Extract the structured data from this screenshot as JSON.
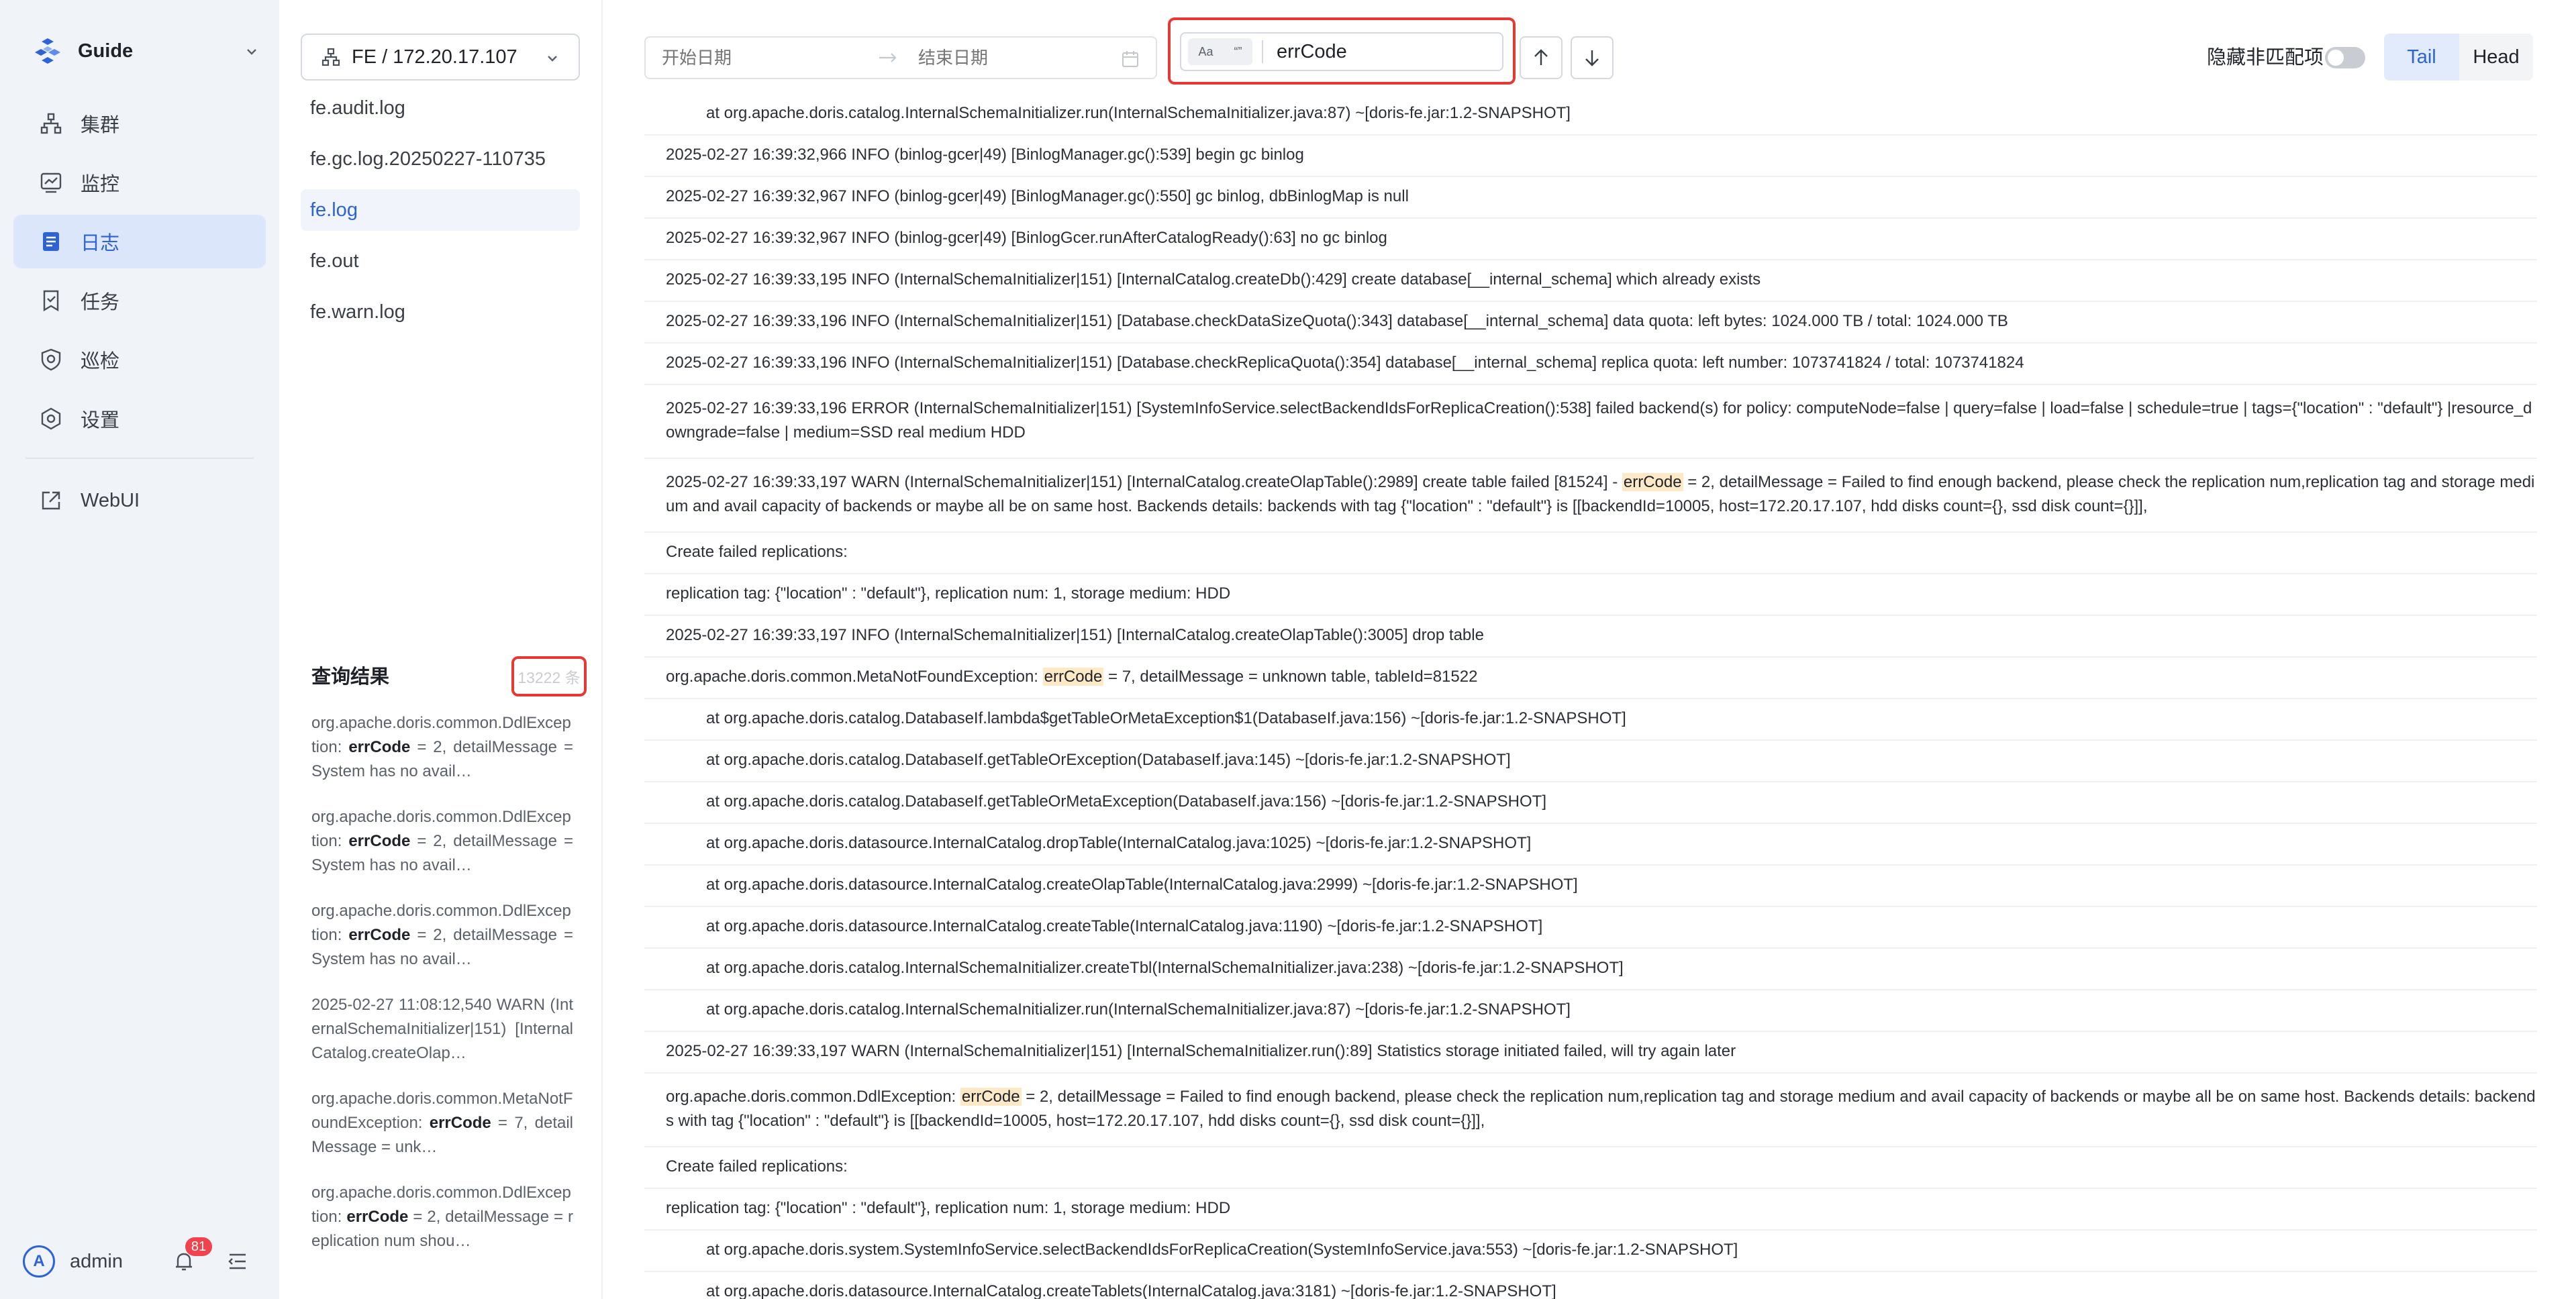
{
  "nav": {
    "brand": "Guide",
    "items": [
      {
        "label": "集群",
        "icon": "cluster-icon"
      },
      {
        "label": "监控",
        "icon": "monitor-icon"
      },
      {
        "label": "日志",
        "icon": "log-icon"
      },
      {
        "label": "任务",
        "icon": "task-icon"
      },
      {
        "label": "巡检",
        "icon": "inspect-icon"
      },
      {
        "label": "设置",
        "icon": "settings-icon"
      }
    ],
    "webui": "WebUI",
    "user": "admin",
    "avatar_letter": "A",
    "notifications": "81"
  },
  "files": {
    "node": "FE / 172.20.17.107",
    "items": [
      "fe.audit.log",
      "fe.gc.log.20250227-110735",
      "fe.log",
      "fe.out",
      "fe.warn.log"
    ],
    "active": "fe.log",
    "result_title": "查询结果",
    "result_count": "13222 条",
    "results": [
      {
        "pre": "org.apache.doris.common.DdlException: ",
        "key": "errCode",
        "post": " = 2, detailMessage = System has no avail…"
      },
      {
        "pre": "org.apache.doris.common.DdlException: ",
        "key": "errCode",
        "post": " = 2, detailMessage = System has no avail…"
      },
      {
        "pre": "org.apache.doris.common.DdlException: ",
        "key": "errCode",
        "post": " = 2, detailMessage = System has no avail…"
      },
      {
        "pre": "2025-02-27 11:08:12,540 WARN (InternalSchemaInitializer|151) [InternalCatalog.createOlap…",
        "key": "",
        "post": ""
      },
      {
        "pre": "org.apache.doris.common.MetaNotFoundException: ",
        "key": "errCode",
        "post": " = 7, detailMessage = unk…"
      },
      {
        "pre": "org.apache.doris.common.DdlException: ",
        "key": "errCode",
        "post": " = 2, detailMessage = replication num shou…"
      }
    ]
  },
  "toolbar": {
    "date_start_placeholder": "开始日期",
    "date_end_placeholder": "结束日期",
    "case_label": "Aa",
    "word_label": "“”",
    "search_value": "errCode",
    "hide_label": "隐藏非匹配项",
    "tail": "Tail",
    "head": "Head",
    "highlight_color": "#fde9c6",
    "accent_color": "#2e63d6",
    "alert_color": "#e53935"
  },
  "log_lines": [
    {
      "indent": true,
      "text": "at org.apache.doris.catalog.InternalSchemaInitializer.run(InternalSchemaInitializer.java:87) ~[doris-fe.jar:1.2-SNAPSHOT]"
    },
    {
      "text": "2025-02-27 16:39:32,966 INFO (binlog-gcer|49) [BinlogManager.gc():539] begin gc binlog"
    },
    {
      "text": "2025-02-27 16:39:32,967 INFO (binlog-gcer|49) [BinlogManager.gc():550] gc binlog, dbBinlogMap is null"
    },
    {
      "text": "2025-02-27 16:39:32,967 INFO (binlog-gcer|49) [BinlogGcer.runAfterCatalogReady():63] no gc binlog"
    },
    {
      "text": "2025-02-27 16:39:33,195 INFO (InternalSchemaInitializer|151) [InternalCatalog.createDb():429] create database[__internal_schema] which already exists"
    },
    {
      "text": "2025-02-27 16:39:33,196 INFO (InternalSchemaInitializer|151) [Database.checkDataSizeQuota():343] database[__internal_schema] data quota: left bytes: 1024.000 TB / total: 1024.000 TB"
    },
    {
      "text": "2025-02-27 16:39:33,196 INFO (InternalSchemaInitializer|151) [Database.checkReplicaQuota():354] database[__internal_schema] replica quota: left number: 1073741824 / total: 1073741824"
    },
    {
      "tall": true,
      "text": "2025-02-27 16:39:33,196 ERROR (InternalSchemaInitializer|151) [SystemInfoService.selectBackendIdsForReplicaCreation():538] failed backend(s) for policy: computeNode=false | query=false | load=false | schedule=true | tags={\"location\" : \"default\"} |resource_downgrade=false | medium=SSD real medium HDD"
    },
    {
      "tall": true,
      "pre": "2025-02-27 16:39:33,197 WARN (InternalSchemaInitializer|151) [InternalCatalog.createOlapTable():2989] create table failed [81524] - ",
      "key": "errCode",
      "post": " = 2, detailMessage = Failed to find enough backend, please check the replication num,replication tag and storage medium and avail capacity of backends or maybe all be on same host. Backends details: backends with tag {\"location\" : \"default\"} is [[backendId=10005, host=172.20.17.107, hdd disks count={}, ssd disk count={}]],"
    },
    {
      "text": "Create failed replications:"
    },
    {
      "text": "replication tag: {\"location\" : \"default\"}, replication num: 1, storage medium: HDD"
    },
    {
      "text": "2025-02-27 16:39:33,197 INFO (InternalSchemaInitializer|151) [InternalCatalog.createOlapTable():3005] drop table"
    },
    {
      "pre": "org.apache.doris.common.MetaNotFoundException: ",
      "key": "errCode",
      "post": " = 7, detailMessage = unknown table, tableId=81522"
    },
    {
      "indent": true,
      "text": "at org.apache.doris.catalog.DatabaseIf.lambda$getTableOrMetaException$1(DatabaseIf.java:156) ~[doris-fe.jar:1.2-SNAPSHOT]"
    },
    {
      "indent": true,
      "text": "at org.apache.doris.catalog.DatabaseIf.getTableOrException(DatabaseIf.java:145) ~[doris-fe.jar:1.2-SNAPSHOT]"
    },
    {
      "indent": true,
      "text": "at org.apache.doris.catalog.DatabaseIf.getTableOrMetaException(DatabaseIf.java:156) ~[doris-fe.jar:1.2-SNAPSHOT]"
    },
    {
      "indent": true,
      "text": "at org.apache.doris.datasource.InternalCatalog.dropTable(InternalCatalog.java:1025) ~[doris-fe.jar:1.2-SNAPSHOT]"
    },
    {
      "indent": true,
      "text": "at org.apache.doris.datasource.InternalCatalog.createOlapTable(InternalCatalog.java:2999) ~[doris-fe.jar:1.2-SNAPSHOT]"
    },
    {
      "indent": true,
      "text": "at org.apache.doris.datasource.InternalCatalog.createTable(InternalCatalog.java:1190) ~[doris-fe.jar:1.2-SNAPSHOT]"
    },
    {
      "indent": true,
      "text": "at org.apache.doris.catalog.InternalSchemaInitializer.createTbl(InternalSchemaInitializer.java:238) ~[doris-fe.jar:1.2-SNAPSHOT]"
    },
    {
      "indent": true,
      "text": "at org.apache.doris.catalog.InternalSchemaInitializer.run(InternalSchemaInitializer.java:87) ~[doris-fe.jar:1.2-SNAPSHOT]"
    },
    {
      "text": "2025-02-27 16:39:33,197 WARN (InternalSchemaInitializer|151) [InternalSchemaInitializer.run():89] Statistics storage initiated failed, will try again later"
    },
    {
      "tall": true,
      "pre": "org.apache.doris.common.DdlException: ",
      "key": "errCode",
      "post": " = 2, detailMessage = Failed to find enough backend, please check the replication num,replication tag and storage medium and avail capacity of backends or maybe all be on same host. Backends details: backends with tag {\"location\" : \"default\"} is [[backendId=10005, host=172.20.17.107, hdd disks count={}, ssd disk count={}]],"
    },
    {
      "text": "Create failed replications:"
    },
    {
      "text": "replication tag: {\"location\" : \"default\"}, replication num: 1, storage medium: HDD"
    },
    {
      "indent": true,
      "text": "at org.apache.doris.system.SystemInfoService.selectBackendIdsForReplicaCreation(SystemInfoService.java:553) ~[doris-fe.jar:1.2-SNAPSHOT]"
    },
    {
      "indent": true,
      "text": "at org.apache.doris.datasource.InternalCatalog.createTablets(InternalCatalog.java:3181) ~[doris-fe.jar:1.2-SNAPSHOT]"
    }
  ]
}
